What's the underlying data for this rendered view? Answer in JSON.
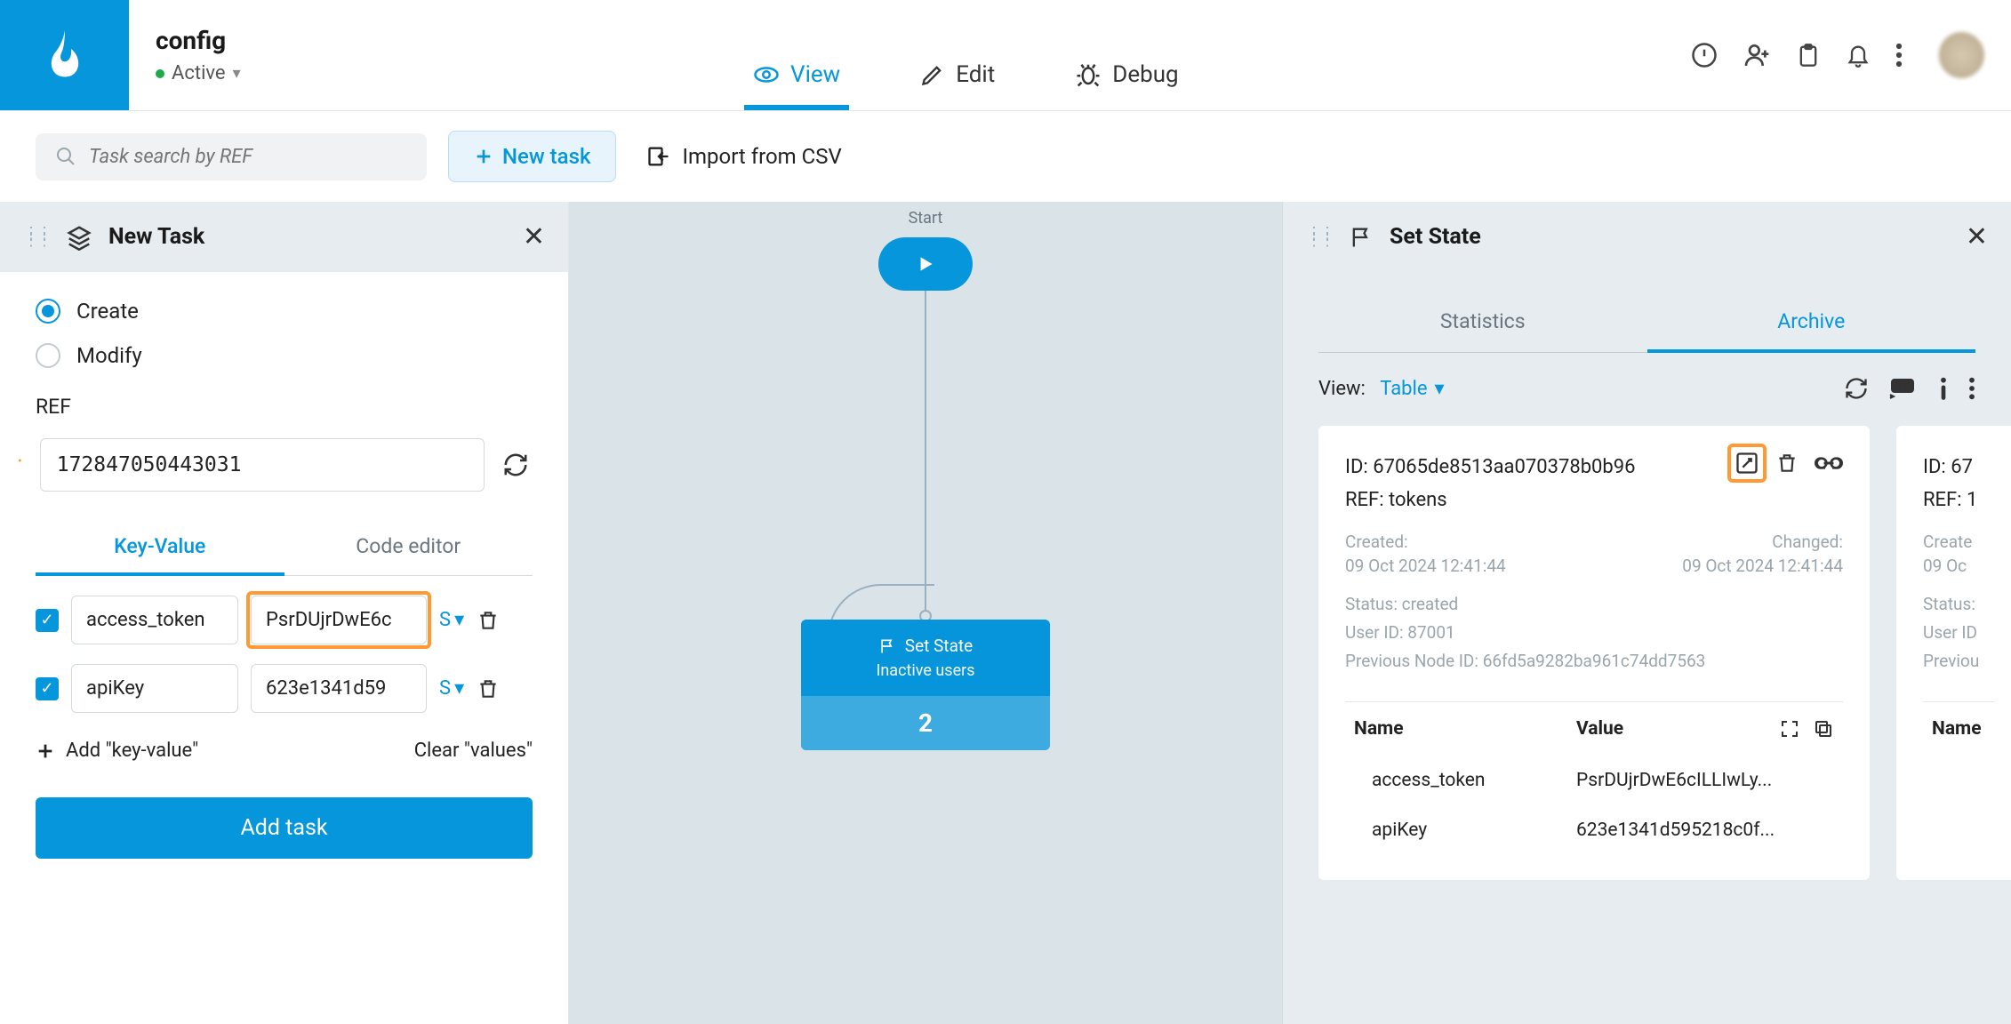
{
  "header": {
    "title": "config",
    "status": "Active",
    "tabs": {
      "view": "View",
      "edit": "Edit",
      "debug": "Debug"
    }
  },
  "toolbar": {
    "search_placeholder": "Task search by REF",
    "new_task": "New task",
    "import_csv": "Import from CSV"
  },
  "left": {
    "title": "New Task",
    "radio_create": "Create",
    "radio_modify": "Modify",
    "ref_label": "REF",
    "ref_value": "172847050443031",
    "subtab_kv": "Key-Value",
    "subtab_code": "Code editor",
    "kv": [
      {
        "key": "access_token",
        "value": "PsrDUjrDwE6c",
        "type": "S"
      },
      {
        "key": "apiKey",
        "value": "623e1341d59",
        "type": "S"
      }
    ],
    "add_kv": "Add \"key-value\"",
    "clear_vals": "Clear \"values\"",
    "add_task": "Add task"
  },
  "canvas": {
    "start": "Start",
    "node_title": "Set State",
    "node_sub": "Inactive users",
    "node_count": "2"
  },
  "right": {
    "title": "Set State",
    "tab_stats": "Statistics",
    "tab_archive": "Archive",
    "view_label": "View:",
    "view_value": "Table",
    "card": {
      "id_label": "ID:",
      "id_value": "67065de8513aa070378b0b96",
      "ref_label": "REF:",
      "ref_value": "tokens",
      "created_label": "Created:",
      "created_value": "09 Oct 2024 12:41:44",
      "changed_label": "Changed:",
      "changed_value": "09 Oct 2024 12:41:44",
      "status": "Status: created",
      "user_id": "User ID: 87001",
      "prev_node": "Previous Node ID: 66fd5a9282ba961c74dd7563",
      "col_name": "Name",
      "col_value": "Value",
      "rows": [
        {
          "name": "access_token",
          "value": "PsrDUjrDwE6cILLIwLy..."
        },
        {
          "name": "apiKey",
          "value": "623e1341d595218c0f..."
        }
      ]
    },
    "peek": {
      "id_label": "ID:",
      "id_value": "67",
      "ref_label": "REF:",
      "ref_value": "1",
      "created_label": "Create",
      "created_value": "09 Oc",
      "status": "Status:",
      "user_id": "User ID",
      "prev_node": "Previou",
      "col_name": "Name"
    }
  }
}
